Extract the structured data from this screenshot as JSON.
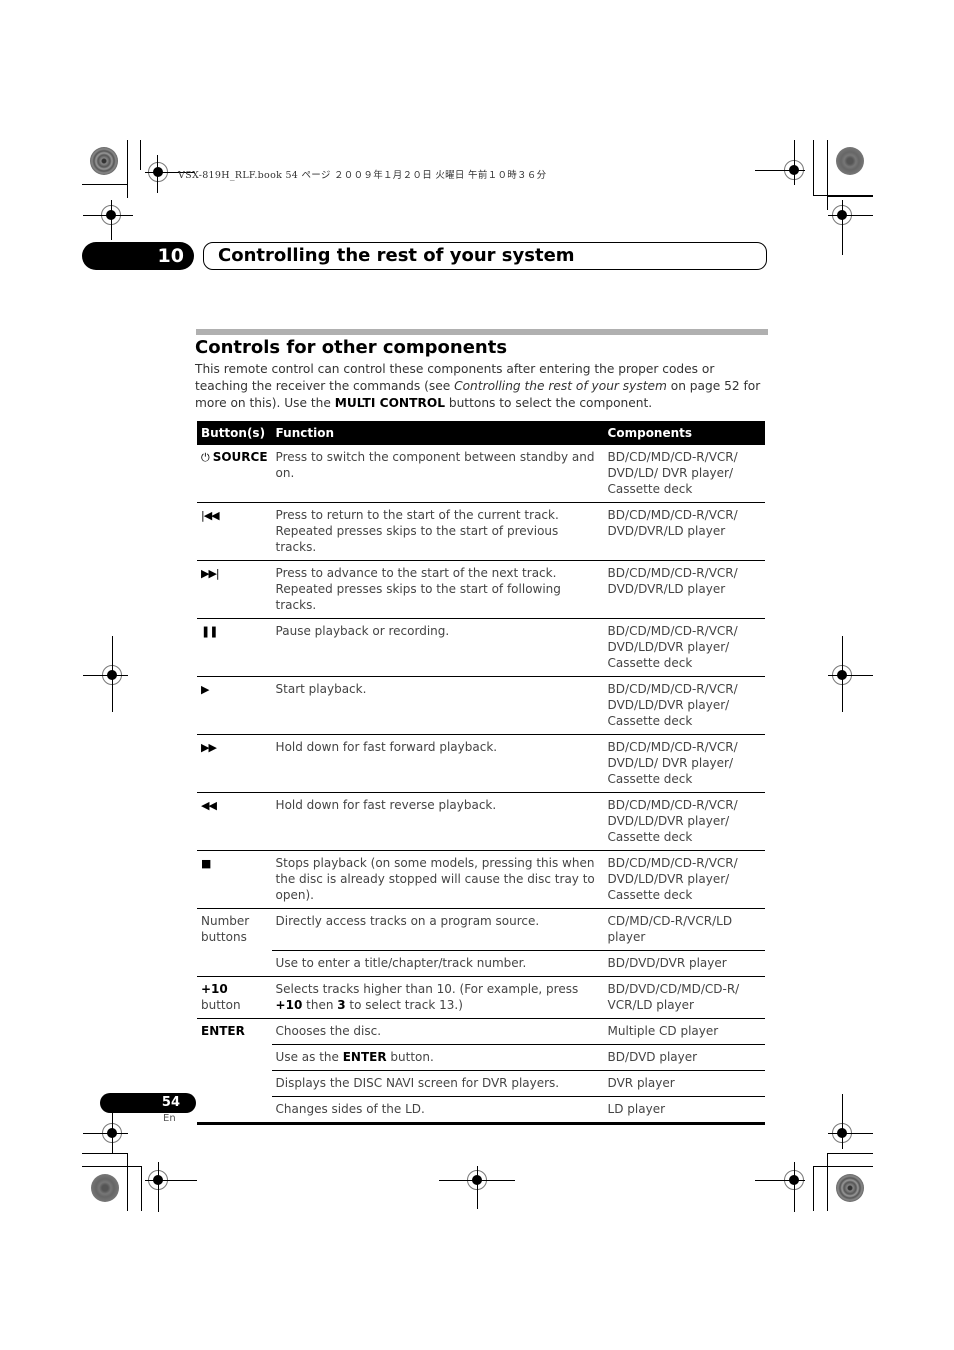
{
  "print_header": {
    "stamp": "VSX-819H_RLF.book  54 ページ  ２００９年１月２０日  火曜日  午前１０時３６分"
  },
  "chapter": {
    "number": "10",
    "title": "Controlling the rest of your system"
  },
  "section": {
    "title": "Controls for other components",
    "intro": {
      "part1": "This remote control can control these components after entering the proper codes or teaching the receiver the commands (see ",
      "italic": "Controlling the rest of your system",
      "part2": " on page 52 for more on this). Use the ",
      "bold": "MULTI CONTROL",
      "part3": " buttons to select the component."
    }
  },
  "table": {
    "headers": [
      "Button(s)",
      "Function",
      "Components"
    ],
    "rows": [
      {
        "button_icon": "power-icon",
        "button_glyph": "⏻",
        "button": "SOURCE",
        "function": "Press to switch the component between standby and on.",
        "components": "BD/CD/MD/CD-R/VCR/ DVD/LD/ DVR player/ Cassette deck"
      },
      {
        "button_icon": "previous-track-icon",
        "button_glyph": "|◀◀",
        "button": "",
        "function": "Press to return to the start of the current track. Repeated presses skips to the start of previous tracks.",
        "components": "BD/CD/MD/CD-R/VCR/ DVD/DVR/LD player"
      },
      {
        "button_icon": "next-track-icon",
        "button_glyph": "▶▶|",
        "button": "",
        "function": "Press to advance to the start of the next track. Repeated presses skips to the start of following tracks.",
        "components": "BD/CD/MD/CD-R/VCR/ DVD/DVR/LD player"
      },
      {
        "button_icon": "pause-icon",
        "button_glyph": "❚❚",
        "button": "",
        "function": "Pause playback or recording.",
        "components": "BD/CD/MD/CD-R/VCR/ DVD/LD/DVR player/ Cassette deck"
      },
      {
        "button_icon": "play-icon",
        "button_glyph": "▶",
        "button": "",
        "function": "Start playback.",
        "components": "BD/CD/MD/CD-R/VCR/ DVD/LD/DVR player/ Cassette deck"
      },
      {
        "button_icon": "fast-forward-icon",
        "button_glyph": "▶▶",
        "button": "",
        "function": "Hold down for fast forward playback.",
        "components": "BD/CD/MD/CD-R/VCR/ DVD/LD/ DVR player/ Cassette deck"
      },
      {
        "button_icon": "rewind-icon",
        "button_glyph": "◀◀",
        "button": "",
        "function": "Hold down for fast reverse playback.",
        "components": "BD/CD/MD/CD-R/VCR/ DVD/LD/DVR player/ Cassette deck"
      },
      {
        "button_icon": "stop-icon",
        "button_glyph": "■",
        "button": "",
        "function": "Stops playback (on some models, pressing this when the disc is already stopped will cause the disc tray to open).",
        "components": "BD/CD/MD/CD-R/VCR/ DVD/LD/DVR player/ Cassette deck"
      }
    ],
    "number_buttons": {
      "button": "Number buttons",
      "rows": [
        {
          "function": "Directly access tracks on a program source.",
          "components": "CD/MD/CD-R/VCR/LD player"
        },
        {
          "function": "Use to enter a title/chapter/track number.",
          "components": "BD/DVD/DVR player"
        }
      ]
    },
    "plus10": {
      "button_bold": "+10",
      "button_rest": " button",
      "function_a": "Selects tracks higher than 10. (For example, press ",
      "function_b": "+10",
      "function_c": " then ",
      "function_d": "3",
      "function_e": " to select track 13.)",
      "components": "BD/DVD/CD/MD/CD-R/ VCR/LD player"
    },
    "enter": {
      "button": "ENTER",
      "rows": [
        {
          "function": "Chooses the disc.",
          "components": "Multiple CD player"
        },
        {
          "function_a": "Use as the ",
          "function_b": "ENTER",
          "function_c": " button.",
          "components": "BD/DVD player"
        },
        {
          "function": "Displays the DISC NAVI screen for DVR players.",
          "components": "DVR player"
        },
        {
          "function": "Changes sides of the LD.",
          "components": "LD player"
        }
      ]
    }
  },
  "footer": {
    "page_number": "54",
    "language": "En"
  }
}
